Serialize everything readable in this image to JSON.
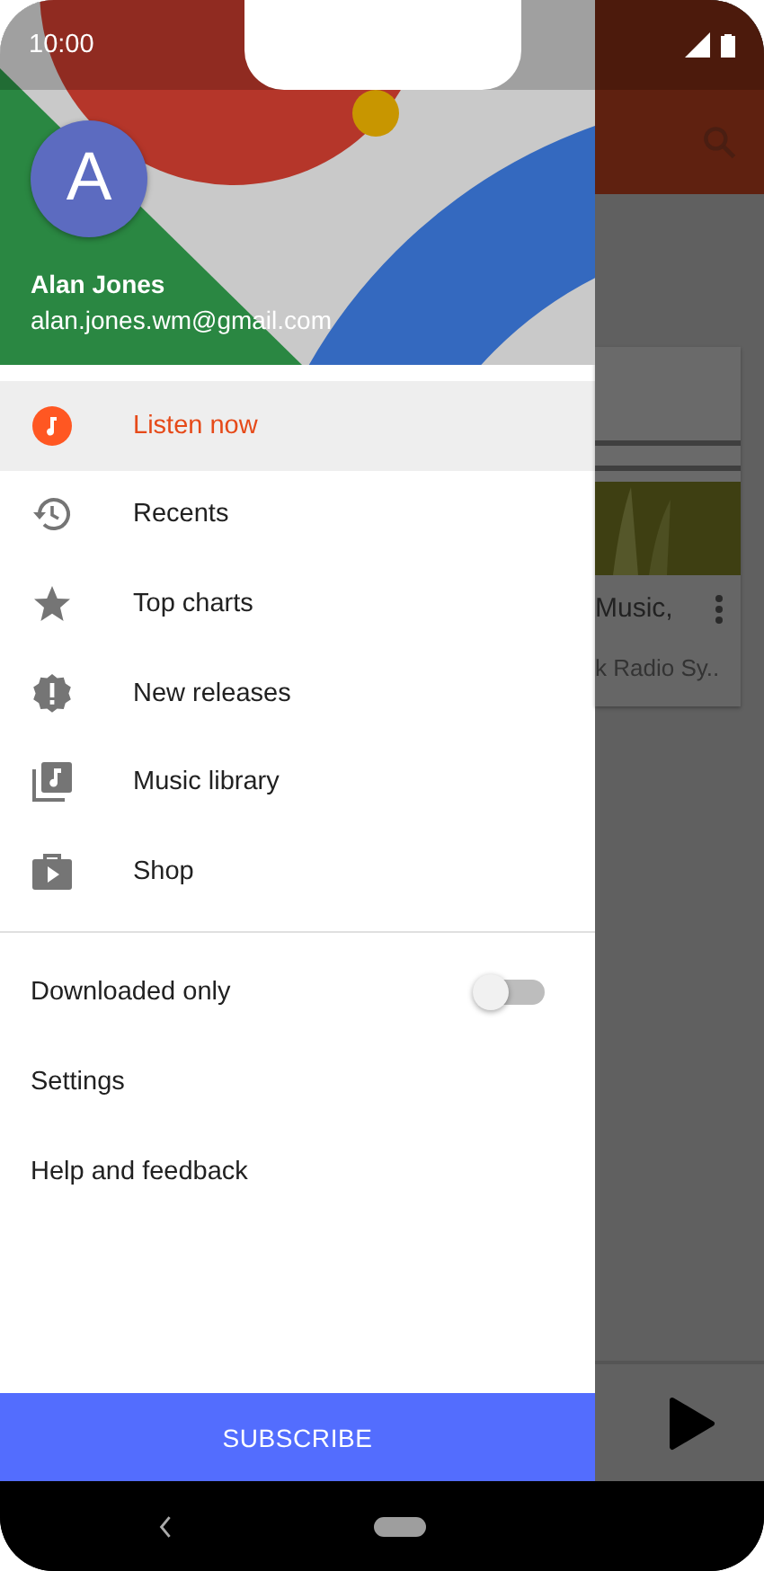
{
  "status_bar": {
    "time": "10:00"
  },
  "drawer": {
    "account": {
      "initial": "A",
      "name": "Alan Jones",
      "email": "alan.jones.wm@gmail.com"
    },
    "nav_items": [
      {
        "label": "Listen now",
        "kind": "listen",
        "selected": true
      },
      {
        "label": "Recents",
        "kind": "recents",
        "selected": false
      },
      {
        "label": "Top charts",
        "kind": "charts",
        "selected": false
      },
      {
        "label": "New releases",
        "kind": "releases",
        "selected": false
      },
      {
        "label": "Music library",
        "kind": "library",
        "selected": false
      },
      {
        "label": "Shop",
        "kind": "shop",
        "selected": false
      }
    ],
    "downloaded_only": {
      "label": "Downloaded only",
      "on": false
    },
    "links": [
      "Settings",
      "Help and feedback"
    ],
    "subscribe_button": "SUBSCRIBE"
  },
  "background_app": {
    "card": {
      "title": "Music,",
      "subtitle": "k Radio Sy.."
    }
  }
}
